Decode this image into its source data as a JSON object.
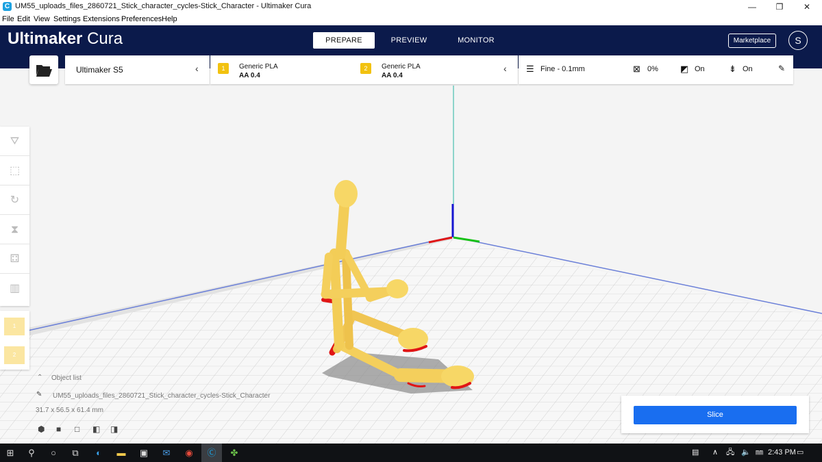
{
  "window": {
    "title": "UM55_uploads_files_2860721_Stick_character_cycles-Stick_Character - Ultimaker Cura",
    "icon": "C",
    "minimize": "—",
    "restore": "❐",
    "close": "✕"
  },
  "menu": [
    "File",
    "Edit",
    "View",
    "Settings",
    "Extensions",
    "Preferences",
    "Help"
  ],
  "header": {
    "logo_bold": "Ultimaker",
    "logo_light": "Cura",
    "tabs": [
      {
        "label": "PREPARE",
        "active": true
      },
      {
        "label": "PREVIEW"
      },
      {
        "label": "MONITOR"
      }
    ],
    "marketplace": "Marketplace",
    "account_initial": "S",
    "background": "#0b1a4b"
  },
  "printer": {
    "name": "Ultimaker S5"
  },
  "extruders": [
    {
      "number": "1",
      "material": "Generic PLA",
      "core": "AA 0.4"
    },
    {
      "number": "2",
      "material": "Generic PLA",
      "core": "AA 0.4"
    }
  ],
  "settings": {
    "profile": "Fine - 0.1mm",
    "infill": "0%",
    "support": "On",
    "adhesion": "On"
  },
  "left_tools": [
    "move-icon",
    "scale-icon",
    "rotate-icon",
    "mirror-icon",
    "per-model-settings-icon",
    "support-blocker-icon"
  ],
  "extruder_tools": [
    "1",
    "2"
  ],
  "object": {
    "list_label": "Object list",
    "name": "UM55_uploads_files_2860721_Stick_character_cycles-Stick_Character",
    "dimensions": "31.7 x 56.5 x 61.4 mm"
  },
  "slice": {
    "label": "Slice",
    "color": "#196ef0"
  },
  "taskbar": {
    "time": "2:43 PM"
  },
  "colors": {
    "model": "#f5d46a",
    "overhang": "#e01515",
    "axis_x": "#e01515",
    "axis_y": "#17c117",
    "axis_z": "#1414d0"
  }
}
